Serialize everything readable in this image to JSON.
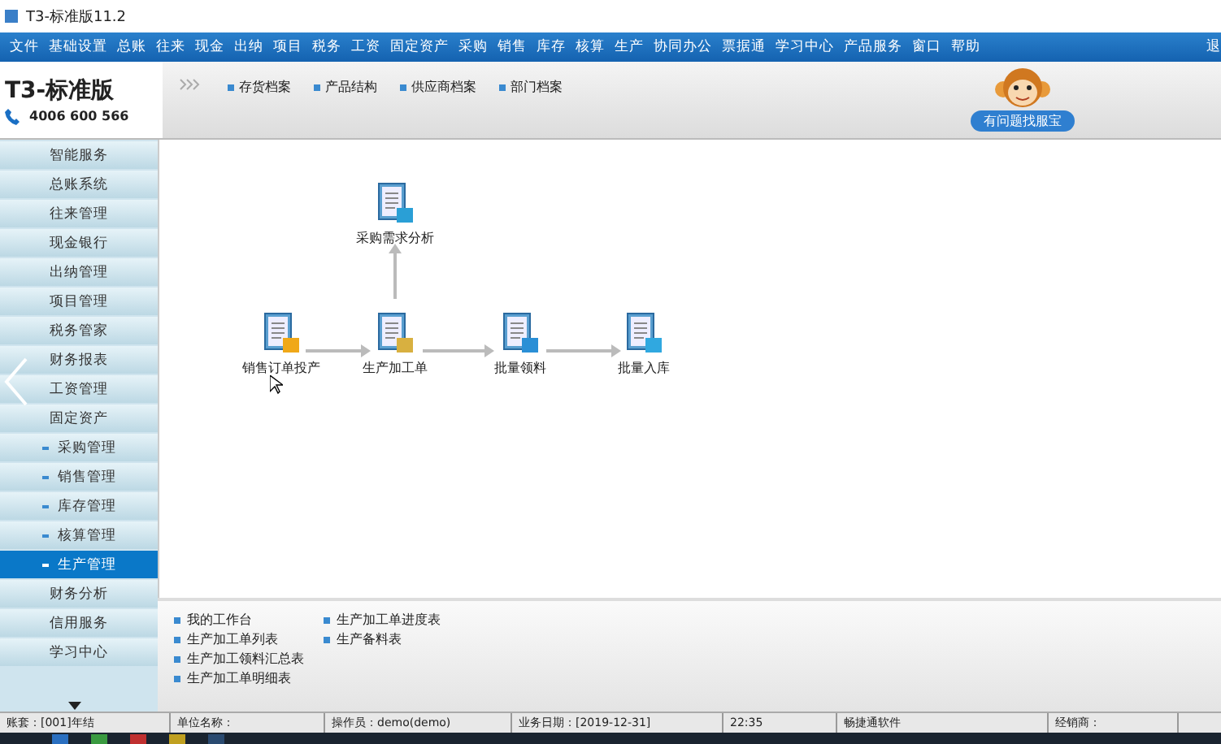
{
  "window": {
    "title": "T3-标准版11.2"
  },
  "menu": [
    "文件",
    "基础设置",
    "总账",
    "往来",
    "现金",
    "出纳",
    "项目",
    "税务",
    "工资",
    "固定资产",
    "采购",
    "销售",
    "库存",
    "核算",
    "生产",
    "协同办公",
    "票据通",
    "学习中心",
    "产品服务",
    "窗口",
    "帮助",
    "退"
  ],
  "logo": {
    "brand": "T3",
    "edition": "-标准版",
    "phone": "4006 600 566"
  },
  "quick_links": [
    "存货档案",
    "产品结构",
    "供应商档案",
    "部门档案"
  ],
  "helper": {
    "label": "有问题找服宝"
  },
  "sidebar": {
    "items": [
      {
        "label": "智能服务",
        "bullet": false,
        "selected": false
      },
      {
        "label": "总账系统",
        "bullet": false,
        "selected": false
      },
      {
        "label": "往来管理",
        "bullet": false,
        "selected": false
      },
      {
        "label": "现金银行",
        "bullet": false,
        "selected": false
      },
      {
        "label": "出纳管理",
        "bullet": false,
        "selected": false
      },
      {
        "label": "项目管理",
        "bullet": false,
        "selected": false
      },
      {
        "label": "税务管家",
        "bullet": false,
        "selected": false
      },
      {
        "label": "财务报表",
        "bullet": false,
        "selected": false
      },
      {
        "label": "工资管理",
        "bullet": false,
        "selected": false
      },
      {
        "label": "固定资产",
        "bullet": false,
        "selected": false
      },
      {
        "label": "采购管理",
        "bullet": true,
        "selected": false
      },
      {
        "label": "销售管理",
        "bullet": true,
        "selected": false
      },
      {
        "label": "库存管理",
        "bullet": true,
        "selected": false
      },
      {
        "label": "核算管理",
        "bullet": true,
        "selected": false
      },
      {
        "label": "生产管理",
        "bullet": true,
        "selected": true
      },
      {
        "label": "财务分析",
        "bullet": false,
        "selected": false
      },
      {
        "label": "信用服务",
        "bullet": false,
        "selected": false
      },
      {
        "label": "学习中心",
        "bullet": false,
        "selected": false
      }
    ]
  },
  "flow": {
    "nodes": [
      {
        "label": "采购需求分析",
        "kind": "cart"
      },
      {
        "label": "销售订单投产",
        "kind": "order"
      },
      {
        "label": "生产加工单",
        "kind": "pen"
      },
      {
        "label": "批量领料",
        "kind": "out"
      },
      {
        "label": "批量入库",
        "kind": "in"
      }
    ]
  },
  "reports": {
    "columns": [
      [
        "我的工作台",
        "生产加工单列表",
        "生产加工领料汇总表",
        "生产加工单明细表"
      ],
      [
        "生产加工单进度表",
        "生产备料表"
      ]
    ]
  },
  "status_bar": [
    "账套：[001]年结",
    "单位名称：",
    "操作员：demo(demo)",
    "业务日期：[2019-12-31]",
    "22:35",
    "畅捷通软件",
    "经销商："
  ]
}
